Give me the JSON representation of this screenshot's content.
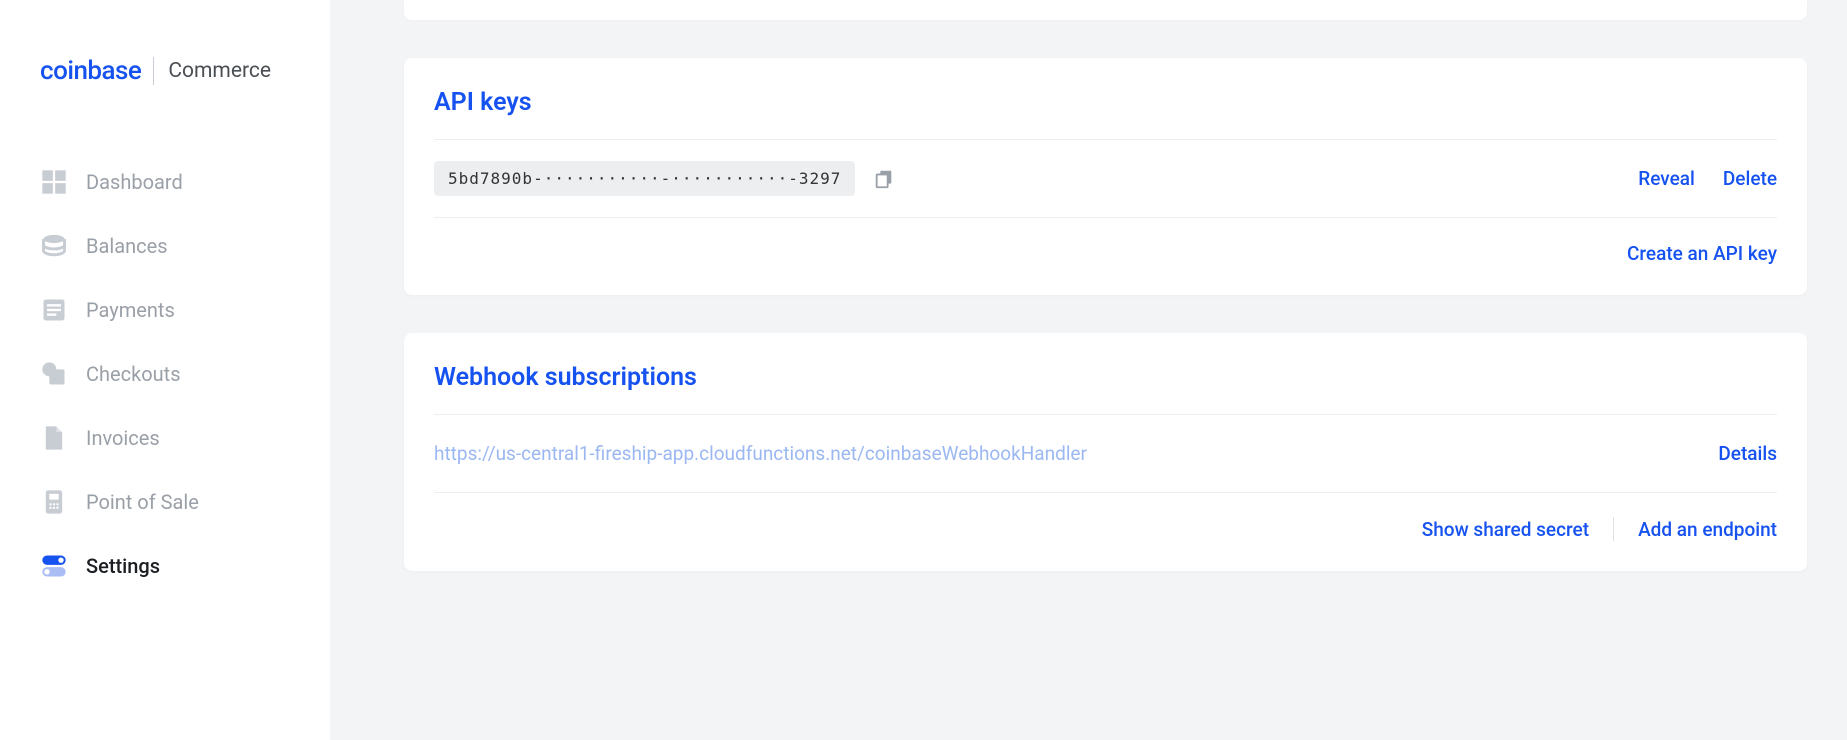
{
  "brand": {
    "name": "coinbase",
    "product": "Commerce"
  },
  "nav": {
    "items": [
      {
        "label": "Dashboard",
        "icon": "dashboard",
        "active": false
      },
      {
        "label": "Balances",
        "icon": "balances",
        "active": false
      },
      {
        "label": "Payments",
        "icon": "payments",
        "active": false
      },
      {
        "label": "Checkouts",
        "icon": "checkouts",
        "active": false
      },
      {
        "label": "Invoices",
        "icon": "invoices",
        "active": false
      },
      {
        "label": "Point of Sale",
        "icon": "pos",
        "active": false
      },
      {
        "label": "Settings",
        "icon": "settings",
        "active": true
      }
    ]
  },
  "api_keys": {
    "title": "API keys",
    "key_masked": "5bd7890b-···········-···········-3297",
    "reveal_label": "Reveal",
    "delete_label": "Delete",
    "create_label": "Create an API key"
  },
  "webhooks": {
    "title": "Webhook subscriptions",
    "url": "https://us-central1-fireship-app.cloudfunctions.net/coinbaseWebhookHandler",
    "details_label": "Details",
    "show_secret_label": "Show shared secret",
    "add_endpoint_label": "Add an endpoint"
  }
}
